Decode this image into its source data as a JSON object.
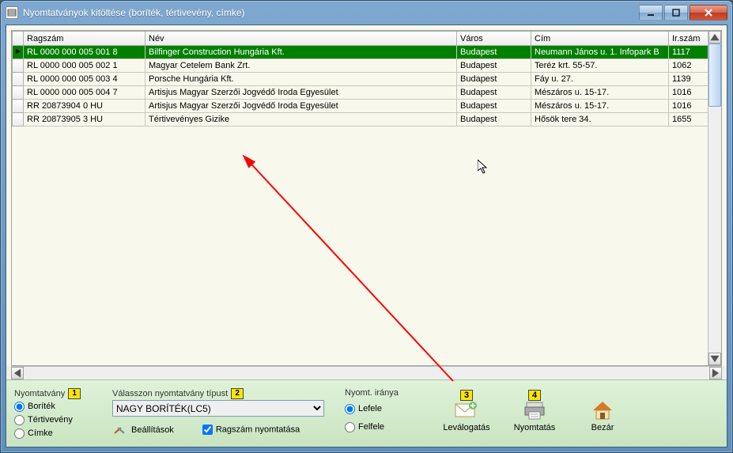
{
  "window": {
    "title": "Nyomtatványok kitöltése (boríték, tértivevény, címke)"
  },
  "columns": {
    "ragszam": "Ragszám",
    "nev": "Név",
    "varos": "Város",
    "cim": "Cím",
    "irszam": "Ir.szám"
  },
  "rows": [
    {
      "ragszam": "RL 0000 000 005 001 8",
      "nev": "Bilfinger Construction Hungária Kft.",
      "varos": "Budapest",
      "cim": "Neumann János u. 1. Infopark B",
      "irszam": "1117",
      "selected": true
    },
    {
      "ragszam": "RL 0000 000 005 002 1",
      "nev": "Magyar Cetelem Bank Zrt.",
      "varos": "Budapest",
      "cim": "Teréz krt. 55-57.",
      "irszam": "1062"
    },
    {
      "ragszam": "RL 0000 000 005 003 4",
      "nev": "Porsche Hungária Kft.",
      "varos": "Budapest",
      "cim": "Fáy u. 27.",
      "irszam": "1139"
    },
    {
      "ragszam": "RL 0000 000 005 004 7",
      "nev": "Artisjus Magyar Szerzői Jogvédő Iroda Egyesület",
      "varos": "Budapest",
      "cim": "Mészáros u. 15-17.",
      "irszam": "1016"
    },
    {
      "ragszam": "RR 20873904 0 HU",
      "nev": "Artisjus Magyar Szerzői Jogvédő Iroda Egyesület",
      "varos": "Budapest",
      "cim": "Mészáros u. 15-17.",
      "irszam": "1016"
    },
    {
      "ragszam": "RR 20873905 3 HU",
      "nev": "Tértivevényes Gizike",
      "varos": "Budapest",
      "cim": "Hősök tere 34.",
      "irszam": "1655"
    }
  ],
  "bottom": {
    "group_nyomtatvany": "Nyomtatvány",
    "radio_boritek": "Boríték",
    "radio_tertivevenyes": "Tértivevény",
    "radio_cimke": "Címke",
    "group_valasszon": "Válasszon nyomtatvány típust",
    "dropdown_value": "NAGY BORÍTÉK(LC5)",
    "beallitasok": "Beállítások",
    "ragszam_nyomtatasa": "Ragszám nyomtatása",
    "group_iranya": "Nyomt. iránya",
    "radio_lefele": "Lefele",
    "radio_felfele": "Felfele",
    "btn_levalogatas": "Leválogatás",
    "btn_nyomtatas": "Nyomtatás",
    "btn_bezar": "Bezár"
  },
  "callouts": {
    "c1": "1",
    "c2": "2",
    "c3": "3",
    "c4": "4"
  }
}
